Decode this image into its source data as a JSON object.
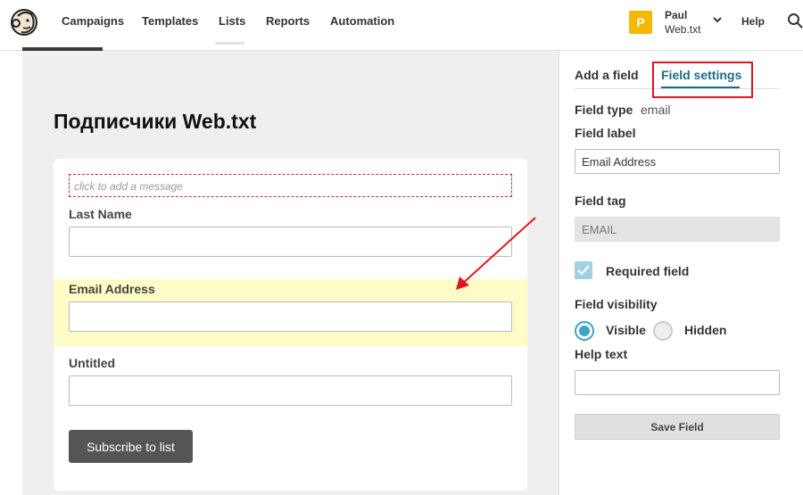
{
  "nav": {
    "items": [
      "Campaigns",
      "Templates",
      "Lists",
      "Reports",
      "Automation"
    ],
    "user_initial": "P",
    "user_name": "Paul",
    "user_org": "Web.txt",
    "help": "Help"
  },
  "form": {
    "title": "Подписчики Web.txt",
    "message_placeholder": "click to add a message",
    "fields": [
      {
        "label": "Last Name"
      },
      {
        "label": "Email Address"
      },
      {
        "label": "Untitled"
      }
    ],
    "submit_label": "Subscribe to list"
  },
  "panel": {
    "tabs": [
      "Add a field",
      "Field settings"
    ],
    "field_type_label": "Field type",
    "field_type_value": "email",
    "field_label_label": "Field label",
    "field_label_value": "Email Address",
    "field_tag_label": "Field tag",
    "field_tag_value": "EMAIL",
    "required_label": "Required field",
    "visibility_label": "Field visibility",
    "visible_label": "Visible",
    "hidden_label": "Hidden",
    "help_text_label": "Help text",
    "help_text_value": "",
    "save_label": "Save Field"
  },
  "colors": {
    "accent": "#1b6b87",
    "highlight": "#fdfcc6",
    "annotation_red": "#e0161e",
    "avatar": "#f5b800"
  }
}
